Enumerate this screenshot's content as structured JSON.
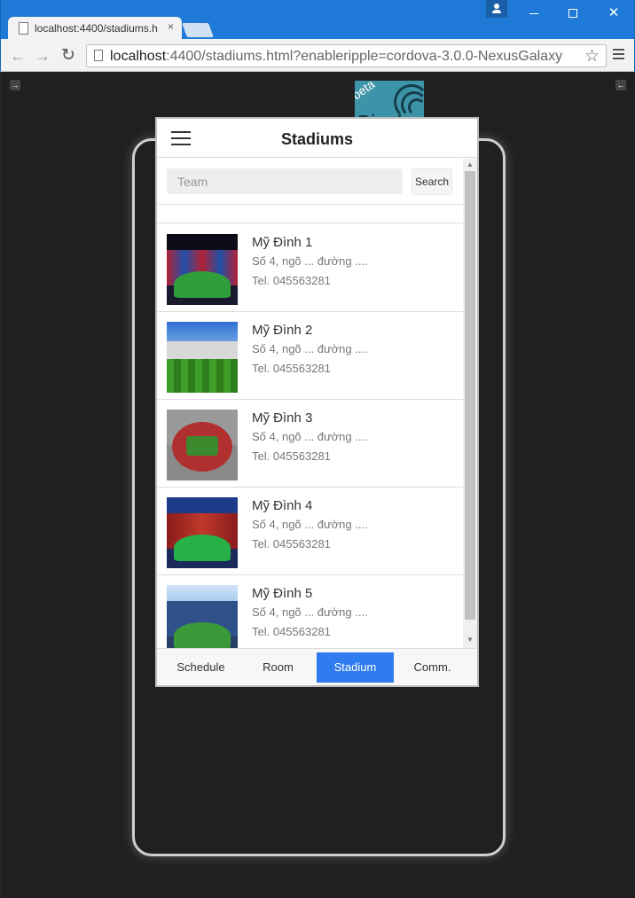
{
  "browser": {
    "tab_title": "localhost:4400/stadiums.h",
    "tab_close": "×",
    "url_host": "localhost",
    "url_rest": ":4400/stadiums.html?enableripple=cordova-3.0.0-NexusGalaxy",
    "icons": {
      "back": "arrow-left-icon",
      "forward": "arrow-right-icon",
      "reload": "reload-icon",
      "star": "star-icon",
      "menu": "hamburger-menu-icon",
      "profile": "user-icon"
    }
  },
  "ripple": {
    "logo_word": "Ripple",
    "logo_beta": "beta",
    "left_toggle": "→",
    "right_toggle": "←"
  },
  "app": {
    "title": "Stadiums",
    "search": {
      "placeholder": "Team",
      "value": "",
      "button_label": "Search"
    },
    "stadiums": [
      {
        "name": "Mỹ Đình 1",
        "address": "Số 4, ngõ ... đường ....",
        "tel": "Tel. 045563281"
      },
      {
        "name": "Mỹ Đình 2",
        "address": "Số 4, ngõ ... đường ....",
        "tel": "Tel. 045563281"
      },
      {
        "name": "Mỹ Đình 3",
        "address": "Số 4, ngõ ... đường ....",
        "tel": "Tel. 045563281"
      },
      {
        "name": "Mỹ Đình 4",
        "address": "Số 4, ngõ ... đường ....",
        "tel": "Tel. 045563281"
      },
      {
        "name": "Mỹ Đình 5",
        "address": "Số 4, ngõ ... đường ....",
        "tel": "Tel. 045563281"
      }
    ],
    "tabs": [
      {
        "label": "Schedule",
        "active": false
      },
      {
        "label": "Room",
        "active": false
      },
      {
        "label": "Stadium",
        "active": true
      },
      {
        "label": "Comm.",
        "active": false
      }
    ]
  },
  "colors": {
    "titlebar": "#1e7ad6",
    "active_tab": "#2f7bf0",
    "ripple_bg": "#202020"
  }
}
